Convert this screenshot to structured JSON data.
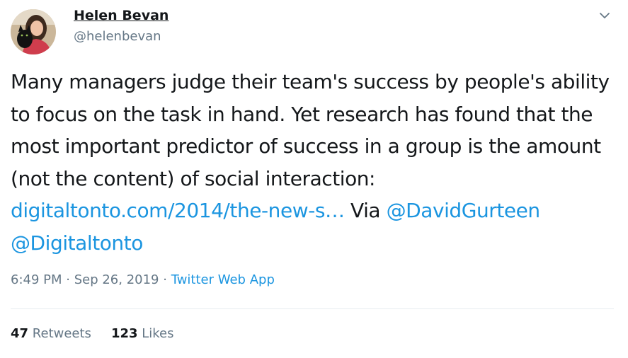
{
  "author": {
    "name": "Helen Bevan",
    "handle": "@helenbevan"
  },
  "tweet": {
    "text_1": "Many managers judge their team's success by people's ability to focus on the task in hand. Yet research has found that the most important predictor of success in a group is the amount (not the content) of social interaction: ",
    "link": "digitaltonto.com/2014/the-new-s…",
    "text_2": " Via ",
    "mention_1": "@DavidGurteen",
    "text_3": " ",
    "mention_2": "@Digitaltonto"
  },
  "meta": {
    "time": "6:49 PM",
    "sep_1": " · ",
    "date": "Sep 26, 2019",
    "sep_2": " · ",
    "source": "Twitter Web App"
  },
  "stats": {
    "retweets_count": "47",
    "retweets_label": "Retweets",
    "likes_count": "123",
    "likes_label": "Likes"
  },
  "icons": {
    "menu": "chevron-down-icon"
  },
  "colors": {
    "link": "#1b95e0",
    "secondary_text": "#657786",
    "primary_text": "#14171a"
  }
}
